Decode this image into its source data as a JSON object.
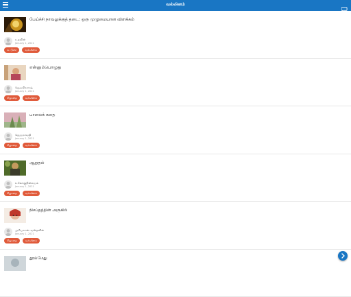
{
  "appbar": {
    "title": "வல்லினம்",
    "menu_icon": "menu-icon",
    "action_icon": "chat-icon",
    "color": "#1976c4"
  },
  "posts": [
    {
      "title": "பேய்ச்சி நாவலுக்குத் தடை: ஒரு முழுமையான விளக்கம்",
      "author": "உதவின்",
      "date": "January 1, 2021",
      "tags": [
        "கட்டுரை",
        "வல்லினம்"
      ]
    },
    {
      "title": "என்னும்பொழுது",
      "author": "ஜெயபிரகாஷ்",
      "date": "January 1, 2021",
      "tags": [
        "சிறுகதை",
        "வல்லினம்"
      ]
    },
    {
      "title": "பாலைக் கதை",
      "author": "ஜெயமாவதி",
      "date": "January 1, 2021",
      "tags": [
        "சிறுகதை",
        "வல்லினம்"
      ]
    },
    {
      "title": "ஆறுதல்",
      "author": "உலோகுநிலையம்",
      "date": "January 1, 2021",
      "tags": [
        "சிறுகதை",
        "வல்லினம்"
      ]
    },
    {
      "title": "நிசப்தத்தின் அருகில்",
      "author": "அரியலான் வஸ்தவின்",
      "date": "January 1, 2021",
      "tags": [
        "சிறுகதை",
        "வல்லினம்"
      ]
    },
    {
      "title": "தூய்மேது",
      "author": "",
      "date": "",
      "tags": []
    }
  ],
  "fab_icon": "chevron-right-icon",
  "tag_color": "#e05a3a"
}
